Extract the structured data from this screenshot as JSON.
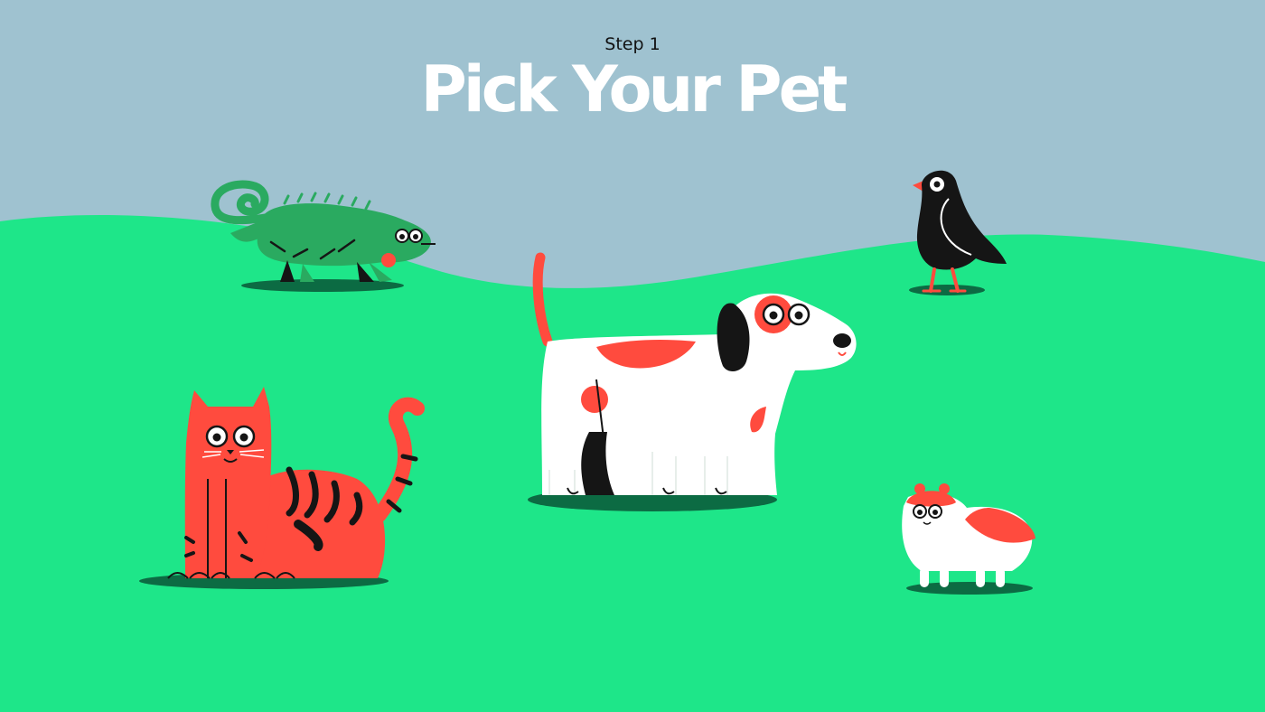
{
  "header": {
    "step_label": "Step 1",
    "title": "Pick Your Pet"
  },
  "colors": {
    "sky": "#9fc2d0",
    "grass": "#1ee689",
    "shadow": "#0c6b43",
    "accent_red": "#ff4b3e",
    "chameleon_green": "#2aaa60",
    "ink": "#151515",
    "white": "#ffffff"
  },
  "pets": [
    {
      "name": "chameleon",
      "icon": "chameleon-icon"
    },
    {
      "name": "bird",
      "icon": "bird-icon"
    },
    {
      "name": "dog",
      "icon": "dog-icon"
    },
    {
      "name": "cat",
      "icon": "cat-icon"
    },
    {
      "name": "hamster",
      "icon": "hamster-icon"
    }
  ]
}
